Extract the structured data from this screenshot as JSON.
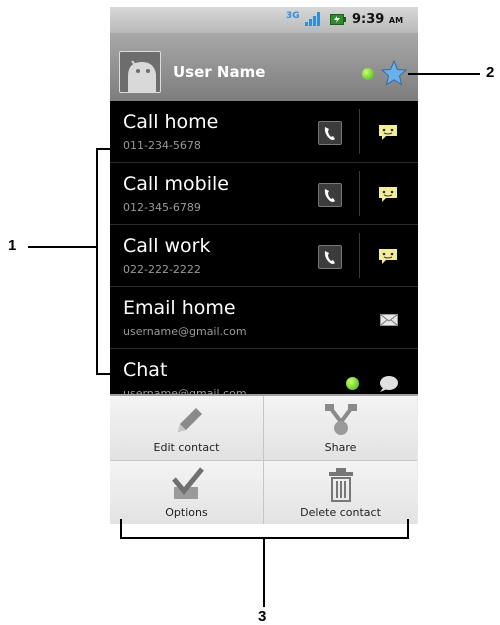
{
  "status_bar": {
    "network": "3G",
    "time": "9:39",
    "ampm": "AM"
  },
  "header": {
    "user_name": "User Name"
  },
  "contact_rows": [
    {
      "title": "Call home",
      "detail": "011-234-5678",
      "actions": [
        "call-icon",
        "sms-icon"
      ]
    },
    {
      "title": "Call mobile",
      "detail": "012-345-6789",
      "actions": [
        "call-icon",
        "sms-icon"
      ]
    },
    {
      "title": "Call work",
      "detail": "022-222-2222",
      "actions": [
        "call-icon",
        "sms-icon"
      ]
    },
    {
      "title": "Email home",
      "detail": "username@gmail.com",
      "actions": [
        "email-icon"
      ]
    },
    {
      "title": "Chat",
      "detail": "username@gmail.com",
      "actions": [
        "presence-icon",
        "chat-icon"
      ]
    }
  ],
  "menu": {
    "edit_contact": "Edit contact",
    "share": "Share",
    "options": "Options",
    "delete_contact": "Delete contact"
  },
  "callouts": {
    "one": "1",
    "two": "2",
    "three": "3"
  },
  "colors": {
    "presence_green": "#3fae12",
    "star_blue": "#6ab0ea",
    "list_bg": "#000000",
    "menu_bg": "#e9e9e9"
  }
}
